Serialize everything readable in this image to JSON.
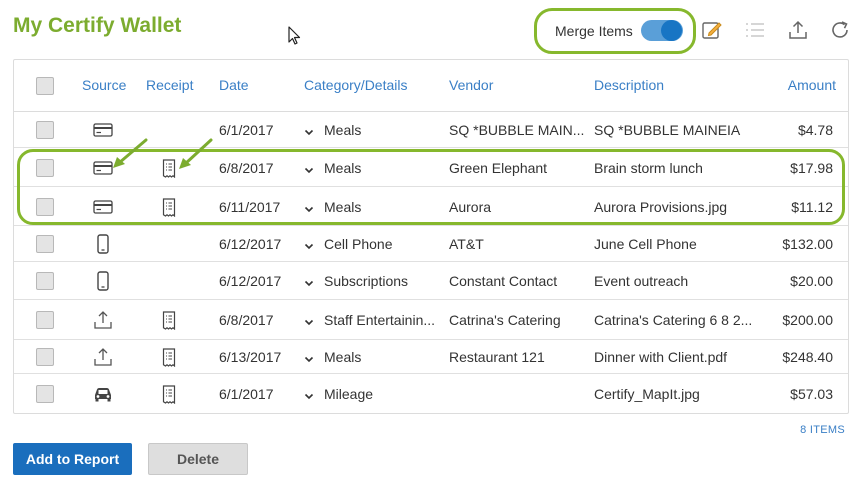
{
  "page": {
    "title": "My Certify Wallet"
  },
  "toolbar": {
    "merge_label": "Merge Items",
    "merge_on": true
  },
  "columns": {
    "source": "Source",
    "receipt": "Receipt",
    "date": "Date",
    "category": "Category/Details",
    "vendor": "Vendor",
    "description": "Description",
    "amount": "Amount"
  },
  "rows": [
    {
      "source": "card-icon",
      "receipt": false,
      "date": "6/1/2017",
      "category": "Meals",
      "vendor": "SQ *BUBBLE MAIN...",
      "description": "SQ *BUBBLE MAINEIA",
      "amount": "$4.78"
    },
    {
      "source": "card-icon",
      "receipt": true,
      "date": "6/8/2017",
      "category": "Meals",
      "vendor": "Green Elephant",
      "description": "Brain storm lunch",
      "amount": "$17.98"
    },
    {
      "source": "card-icon",
      "receipt": true,
      "date": "6/11/2017",
      "category": "Meals",
      "vendor": "Aurora",
      "description": "Aurora Provisions.jpg",
      "amount": "$11.12"
    },
    {
      "source": "phone-icon",
      "receipt": false,
      "date": "6/12/2017",
      "category": "Cell Phone",
      "vendor": "AT&T",
      "description": "June Cell Phone",
      "amount": "$132.00"
    },
    {
      "source": "phone-icon",
      "receipt": false,
      "date": "6/12/2017",
      "category": "Subscriptions",
      "vendor": "Constant Contact",
      "description": "Event outreach",
      "amount": "$20.00"
    },
    {
      "source": "upload-icon",
      "receipt": true,
      "date": "6/8/2017",
      "category": "Staff Entertainin...",
      "vendor": "Catrina's Catering",
      "description": "Catrina's Catering 6 8 2...",
      "amount": "$200.00"
    },
    {
      "source": "upload-icon",
      "receipt": true,
      "date": "6/13/2017",
      "category": "Meals",
      "vendor": "Restaurant 121",
      "description": "Dinner with Client.pdf",
      "amount": "$248.40"
    },
    {
      "source": "car-icon",
      "receipt": true,
      "date": "6/1/2017",
      "category": "Mileage",
      "vendor": "",
      "description": "Certify_MapIt.jpg",
      "amount": "$57.03"
    }
  ],
  "footer": {
    "count": "8 ITEMS",
    "add_label": "Add to Report",
    "delete_label": "Delete"
  },
  "colors": {
    "accent_green": "#7cac2f",
    "highlight": "#86b82d",
    "link_blue": "#3a7fc6",
    "primary_button": "#1a6ebd"
  }
}
